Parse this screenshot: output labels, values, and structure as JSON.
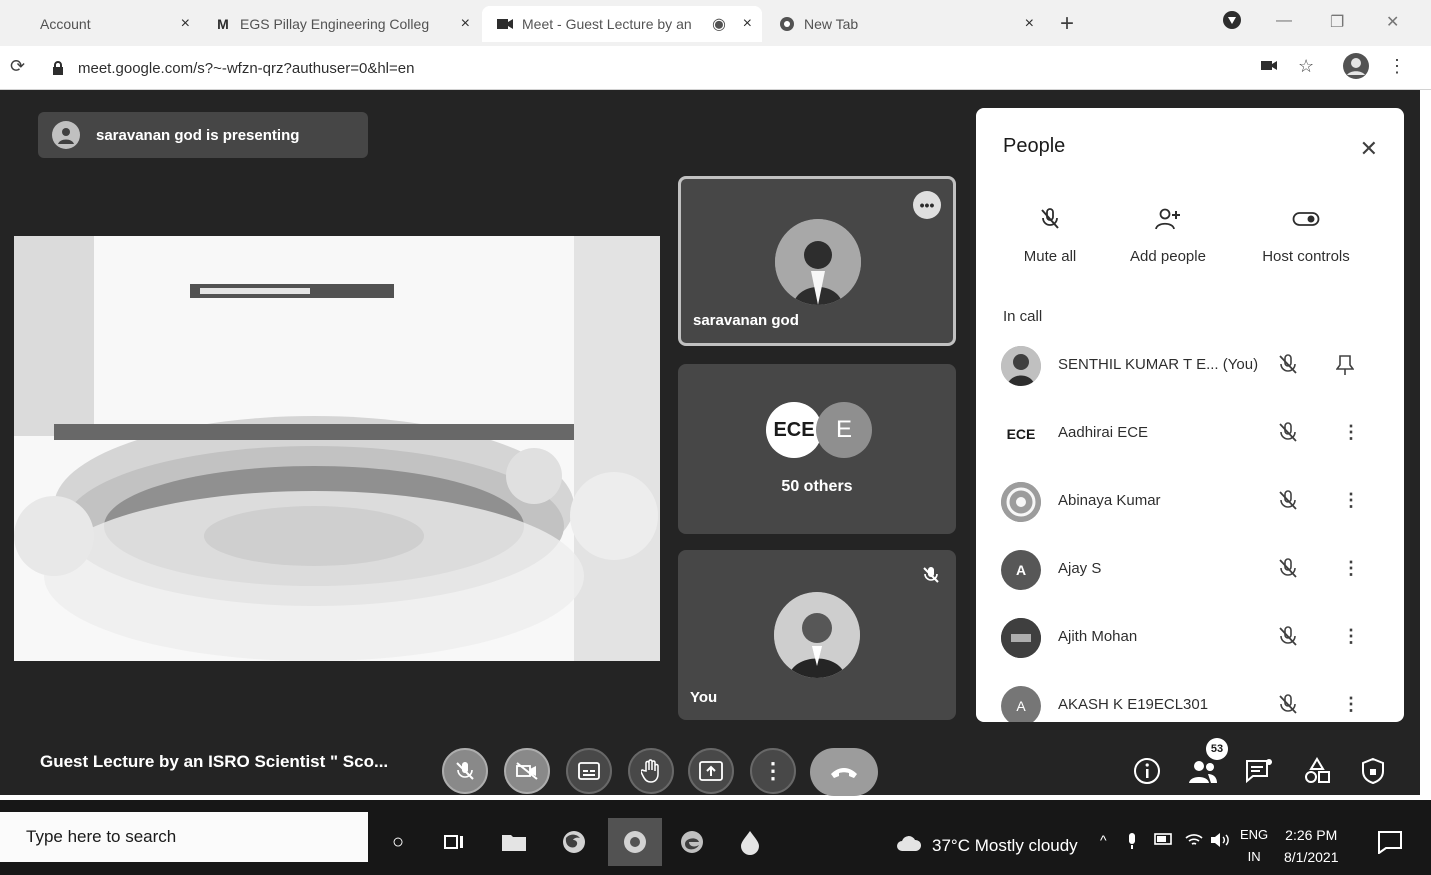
{
  "tabs": [
    {
      "label": "Account",
      "icon": "account-icon"
    },
    {
      "label": "EGS Pillay Engineering Colleg",
      "icon": "gmail-icon"
    },
    {
      "label": "Meet - Guest Lecture by an",
      "icon": "meet-icon"
    },
    {
      "label": "New Tab",
      "icon": "chrome-icon"
    }
  ],
  "address": {
    "url": "meet.google.com/s?~-wfzn-qrz?authuser=0&hl=en"
  },
  "presenting_banner": "saravanan god is presenting",
  "tiles": {
    "presenter_name": "saravanan god",
    "group_badges": [
      "ECE",
      "E"
    ],
    "others_label": "50 others",
    "self_name": "You"
  },
  "people": {
    "title": "People",
    "actions": [
      {
        "label": "Mute all"
      },
      {
        "label": "Add people"
      },
      {
        "label": "Host controls"
      }
    ],
    "section": "In call",
    "rows": [
      {
        "name": "SENTHIL KUMAR T E... (You)",
        "avatar": ""
      },
      {
        "name": "Aadhirai ECE",
        "avatar": "ECE"
      },
      {
        "name": "Abinaya Kumar",
        "avatar": ""
      },
      {
        "name": "Ajay S",
        "avatar": "A"
      },
      {
        "name": "Ajith Mohan",
        "avatar": ""
      },
      {
        "name": "AKASH K E19ECL301",
        "avatar": "A"
      }
    ]
  },
  "meeting_title": "Guest Lecture by an ISRO Scientist \" Sco...",
  "participants_badge": "53",
  "taskbar": {
    "search_placeholder": "Type here to search",
    "weather": "37°C  Mostly cloudy",
    "lang1": "ENG",
    "lang2": "IN",
    "time": "2:26 PM",
    "date": "8/1/2021"
  }
}
